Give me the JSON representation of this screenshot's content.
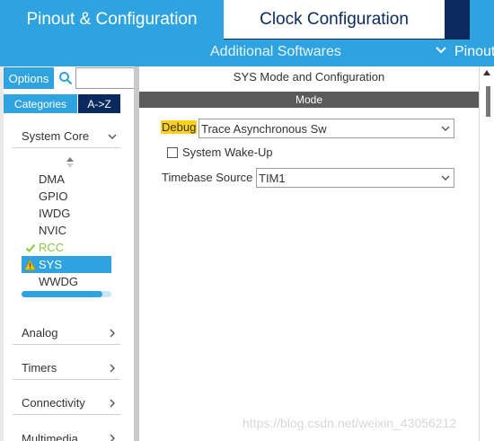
{
  "top_tabs": {
    "pinout": "Pinout & Configuration",
    "clock": "Clock Configuration"
  },
  "subbar": {
    "additional_softwares": "Additional Softwares",
    "pinout_menu": "Pinout"
  },
  "left_panel": {
    "options_label": "Options",
    "search_placeholder": "",
    "categories_label": "Categories",
    "az_label": "A->Z",
    "system_core_label": "System Core",
    "peripherals": [
      {
        "label": "DMA",
        "status": "none"
      },
      {
        "label": "GPIO",
        "status": "none"
      },
      {
        "label": "IWDG",
        "status": "none"
      },
      {
        "label": "NVIC",
        "status": "none"
      },
      {
        "label": "RCC",
        "status": "ok"
      },
      {
        "label": "SYS",
        "status": "warning"
      },
      {
        "label": "WWDG",
        "status": "none"
      }
    ],
    "categories": [
      "Analog",
      "Timers",
      "Connectivity",
      "Multimedia"
    ]
  },
  "main_panel": {
    "title": "SYS Mode and Configuration",
    "mode_header": "Mode",
    "debug_label": "Debug",
    "debug_value": "Trace Asynchronous Sw",
    "wakeup_label": "System Wake-Up",
    "wakeup_checked": false,
    "timebase_label": "Timebase Source",
    "timebase_value": "TIM1"
  },
  "watermark": "https://blog.csdn.net/weixin_43056212",
  "colors": {
    "accent": "#2ea3df",
    "navy": "#0a2a5e",
    "ok": "#8bc53f",
    "warning": "#f2c200",
    "mode_bar": "#5a5a5a"
  }
}
